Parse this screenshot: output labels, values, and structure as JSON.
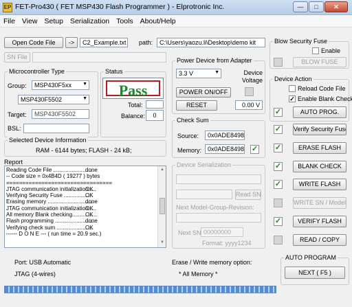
{
  "window": {
    "title": "FET-Pro430  ( FET MSP430 Flash Programmer )  -  Elprotronic Inc.",
    "app_icon_text": "EP",
    "minimize_glyph": "—",
    "maximize_glyph": "□",
    "close_glyph": "✕"
  },
  "menu": [
    "File",
    "View",
    "Setup",
    "Serialization",
    "Tools",
    "About/Help"
  ],
  "code_file": {
    "open_button": "Open Code File",
    "arrow_button": "->",
    "file_name": "C2_Example.txt",
    "path_label": "path:",
    "path_value": "C:\\Users\\yaozu.li\\Desktop\\demo kit",
    "sn_file_button": "SN File"
  },
  "microcontroller": {
    "group_label": "Microcontroller Type",
    "group_field_label": "Group:",
    "group_value": "MSP430F5xx",
    "device_value": "MSP430F5502",
    "target_label": "Target:",
    "target_value": "MSP430F5502",
    "bsl_label": "BSL:",
    "bsl_value": ""
  },
  "status": {
    "group_label": "Status",
    "result": "Pass",
    "total_label": "Total:",
    "total_value": "",
    "balance_label": "Balance:",
    "balance_value": "0"
  },
  "device_info": {
    "group_label": "Selected Device Information",
    "text": "RAM - 6144 bytes;     FLASH - 24 kB;"
  },
  "report": {
    "label": "Report",
    "lines": [
      {
        "text": "Reading Code File ...........................",
        "result": "done"
      },
      {
        "text": "-- Code size = 0x4B4D  ( 19277 ) bytes",
        "result": ""
      },
      {
        "text": "=================================",
        "result": ""
      },
      {
        "text": "JTAG communication initialization.....",
        "result": "OK"
      },
      {
        "text": "Verifying Security Fuse .................",
        "result": "OK"
      },
      {
        "text": "Erasing memory ..............................",
        "result": "done"
      },
      {
        "text": "JTAG communication initialization.....",
        "result": "OK"
      },
      {
        "text": "All memory Blank checking................",
        "result": "OK"
      },
      {
        "text": "Flash programming ..........................",
        "result": "done"
      },
      {
        "text": "Verifying check sum ........................",
        "result": "OK"
      },
      {
        "text": "------ D O N E --- ( run time =  20.9 sec.)",
        "result": ""
      }
    ]
  },
  "power": {
    "group_label": "Power Device from Adapter",
    "voltage_value": "3.3 V",
    "device_voltage_label": "Device Voltage",
    "power_button": "POWER ON/OFF",
    "reset_button": "RESET",
    "voltage_reading": "0.00 V"
  },
  "checksum": {
    "group_label": "Check Sum",
    "source_label": "Source:",
    "source_value": "0x0ADE8498",
    "memory_label": "Memory:",
    "memory_value": "0x0ADE8498"
  },
  "serialization": {
    "group_label": "Device Serialization",
    "read_sn_button": "Read SN",
    "revision_label": "Next Model-Group-Revision:",
    "next_sn_label": "Next SN:",
    "next_sn_value": "00000000",
    "format_label": "Format: yyyy1234"
  },
  "security_fuse": {
    "group_label": "Blow Security Fuse",
    "enable_label": "Enable",
    "blow_button": "BLOW FUSE"
  },
  "device_action": {
    "group_label": "Device Action",
    "reload_label": "Reload Code File",
    "blank_check_label": "Enable Blank Check",
    "auto_prog_button": "AUTO PROG.",
    "actions": [
      {
        "label": "Verify Security Fuse",
        "checked": true
      },
      {
        "label": "ERASE FLASH",
        "checked": true
      },
      {
        "label": "BLANK CHECK",
        "checked": true
      },
      {
        "label": "WRITE FLASH",
        "checked": true
      },
      {
        "label": "WRITE SN / Model",
        "checked": false
      },
      {
        "label": "VERIFY FLASH",
        "checked": true
      },
      {
        "label": "READ / COPY",
        "checked": false
      }
    ]
  },
  "footer": {
    "port_text": "Port: USB Automatic",
    "jtag_text": "JTAG (4-wires)",
    "erase_option_label": "Erase / Write memory option:",
    "erase_option_value": "* All Memory *",
    "auto_program_label": "AUTO PROGRAM",
    "next_button": "NEXT  ( F5 )",
    "progress": 1.0
  },
  "colors": {
    "pass_text": "#1b8a2c",
    "pass_border": "#b81b1b",
    "check_mark": "#1e8a1e",
    "progress_fill": "#4a8fdc"
  }
}
